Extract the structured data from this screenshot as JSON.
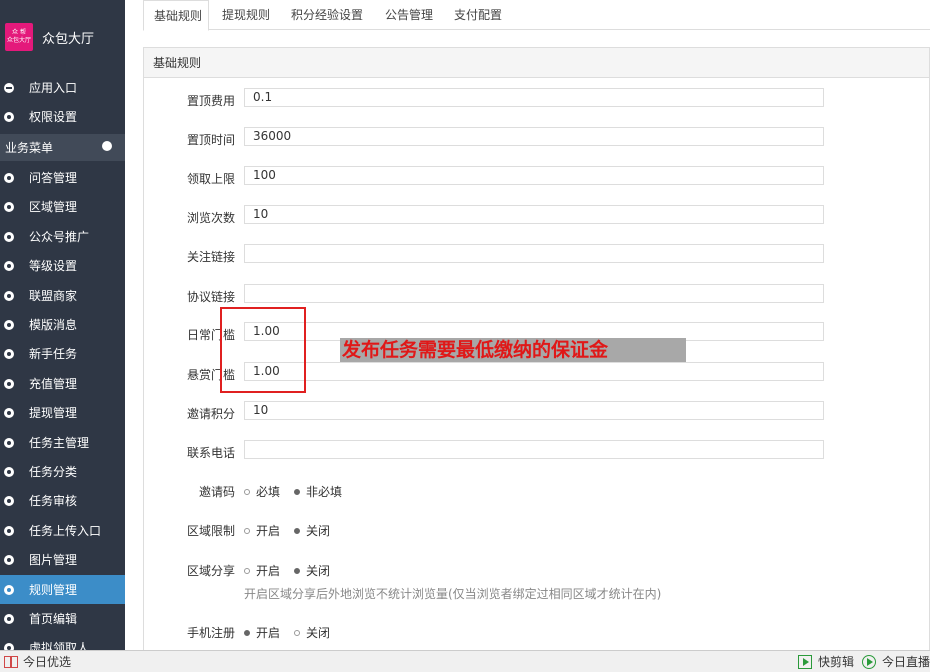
{
  "sidebar": {
    "logo_text_line1": "众 帮",
    "logo_text_line2": "众包大厅",
    "title": "众包大厅",
    "top_items": [
      {
        "label": "应用入口",
        "icon": "minus-circle-icon"
      },
      {
        "label": "权限设置",
        "icon": "gear-icon"
      }
    ],
    "group_label": "业务菜单",
    "items": [
      {
        "label": "问答管理"
      },
      {
        "label": "区域管理"
      },
      {
        "label": "公众号推广"
      },
      {
        "label": "等级设置"
      },
      {
        "label": "联盟商家"
      },
      {
        "label": "模版消息"
      },
      {
        "label": "新手任务"
      },
      {
        "label": "充值管理"
      },
      {
        "label": "提现管理"
      },
      {
        "label": "任务主管理"
      },
      {
        "label": "任务分类"
      },
      {
        "label": "任务审核"
      },
      {
        "label": "任务上传入口"
      },
      {
        "label": "图片管理"
      },
      {
        "label": "规则管理",
        "active": true
      },
      {
        "label": "首页编辑"
      },
      {
        "label": "虚拟领取人"
      }
    ]
  },
  "tabs": [
    "基础规则",
    "提现规则",
    "积分经验设置",
    "公告管理",
    "支付配置"
  ],
  "panel_title": "基础规则",
  "fields": [
    {
      "label": "置顶费用",
      "value": "0.1"
    },
    {
      "label": "置顶时间",
      "value": "36000"
    },
    {
      "label": "领取上限",
      "value": "100"
    },
    {
      "label": "浏览次数",
      "value": "10"
    },
    {
      "label": "关注链接",
      "value": ""
    },
    {
      "label": "协议链接",
      "value": ""
    },
    {
      "label": "日常门槛",
      "value": "1.00"
    },
    {
      "label": "悬赏门槛",
      "value": "1.00"
    },
    {
      "label": "邀请积分",
      "value": "10"
    },
    {
      "label": "联系电话",
      "value": ""
    }
  ],
  "radios": [
    {
      "label": "邀请码",
      "options": [
        "必填",
        "非必填"
      ],
      "selected": 1
    },
    {
      "label": "区域限制",
      "options": [
        "开启",
        "关闭"
      ],
      "selected": 1
    },
    {
      "label": "区域分享",
      "options": [
        "开启",
        "关闭"
      ],
      "selected": 1
    },
    {
      "label": "手机注册",
      "options": [
        "开启",
        "关闭"
      ],
      "selected": 0
    }
  ],
  "share_hint": "开启区域分享后外地浏览不统计浏览量(仅当浏览者绑定过相同区域才统计在内)",
  "annotation": "发布任务需要最低缴纳的保证金",
  "taskbar": {
    "left": "今日优选",
    "right1": "快剪辑",
    "right2": "今日直播"
  },
  "colors": {
    "sidebar_bg": "#2f3745",
    "active_item": "#3c8dc8",
    "annotation_red": "#e01818"
  }
}
